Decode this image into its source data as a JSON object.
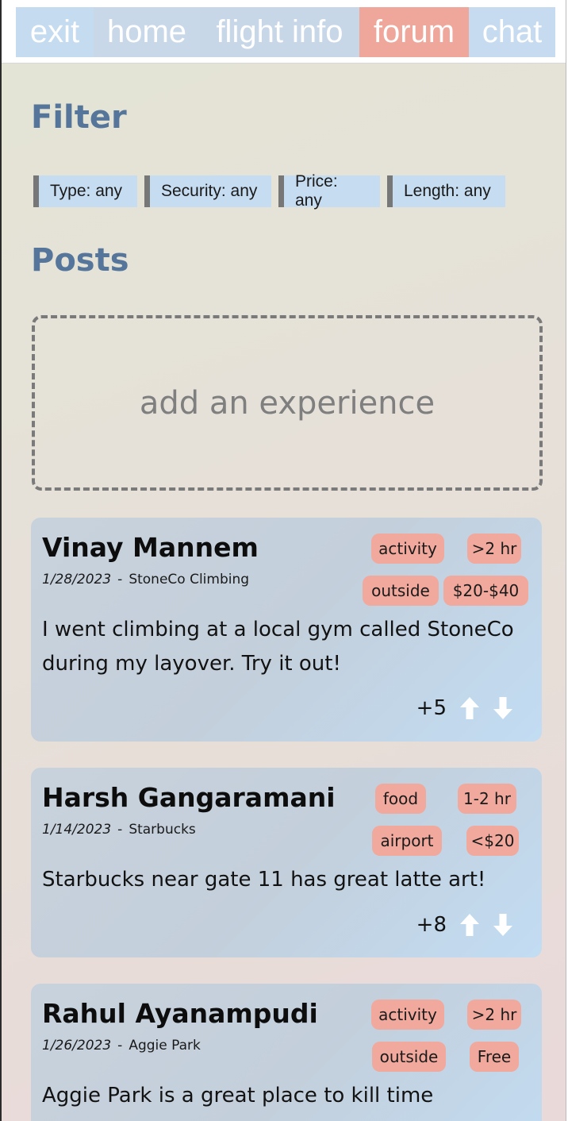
{
  "nav": {
    "exit": "exit",
    "home": "home",
    "flight_info": "flight info",
    "forum": "forum",
    "chat": "chat",
    "active": "forum"
  },
  "filter": {
    "title": "Filter",
    "chips": [
      "Type: any",
      "Security: any",
      "Price: any",
      "Length: any"
    ]
  },
  "posts_section": {
    "title": "Posts",
    "add_label": "add an experience"
  },
  "posts": [
    {
      "author": "Vinay Mannem",
      "date": "1/28/2023",
      "separator": "-",
      "place": "StoneCo Climbing",
      "tags": [
        "activity",
        ">2 hr",
        "outside",
        "$20-$40"
      ],
      "body": "I went climbing at a local gym called StoneCo during my layover. Try it out!",
      "votes": "+5"
    },
    {
      "author": "Harsh Gangaramani",
      "date": "1/14/2023",
      "separator": "-",
      "place": "Starbucks",
      "tags": [
        "food",
        "1-2 hr",
        "airport",
        "<$20"
      ],
      "body": "Starbucks near gate 11 has great latte art!",
      "votes": "+8"
    },
    {
      "author": "Rahul Ayanampudi",
      "date": "1/26/2023",
      "separator": "-",
      "place": "Aggie Park",
      "tags": [
        "activity",
        ">2 hr",
        "outside",
        "Free"
      ],
      "body": "Aggie Park is a great place to kill time",
      "votes": ""
    }
  ],
  "colors": {
    "nav_blue": "#c5dbf0",
    "nav_active": "#eea79a",
    "heading": "#55769a",
    "tag": "#f0a99c",
    "chip": "#c6dcf1"
  },
  "icons": {
    "upvote": "arrow-up-icon",
    "downvote": "arrow-down-icon"
  }
}
